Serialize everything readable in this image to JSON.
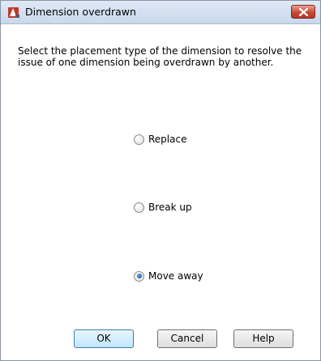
{
  "window": {
    "title": "Dimension overdrawn",
    "app_icon": "autocad-icon",
    "close_icon": "close-icon"
  },
  "description": "Select the placement type of the dimension to resolve the issue of one dimension being overdrawn by another.",
  "options": [
    {
      "label": "Replace",
      "checked": false
    },
    {
      "label": "Break up",
      "checked": false
    },
    {
      "label": "Move away",
      "checked": true
    }
  ],
  "buttons": {
    "ok": "OK",
    "cancel": "Cancel",
    "help": "Help"
  },
  "colors": {
    "selected_radio": "#1f5fae",
    "default_button": "#bee6fd"
  }
}
